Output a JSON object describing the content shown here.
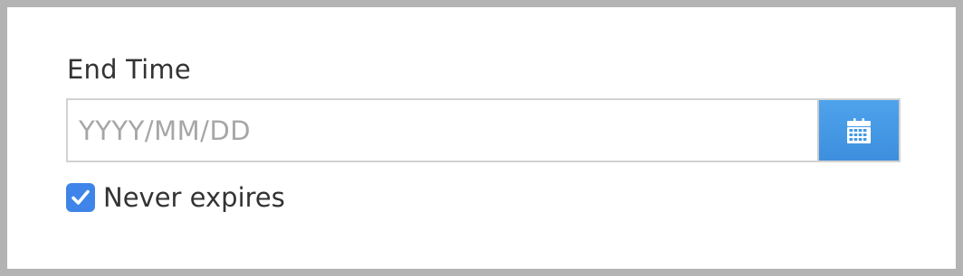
{
  "end_time": {
    "label": "End Time",
    "input": {
      "value": "",
      "placeholder": "YYYY/MM/DD"
    },
    "calendar_button_icon": "calendar-icon"
  },
  "never_expires": {
    "label": "Never expires",
    "checked": true
  },
  "colors": {
    "accent": "#3f84e8",
    "calendar_button": "#4499e6",
    "frame_border": "#b3b3b3",
    "text": "#333333",
    "placeholder": "#a6a6a6"
  }
}
